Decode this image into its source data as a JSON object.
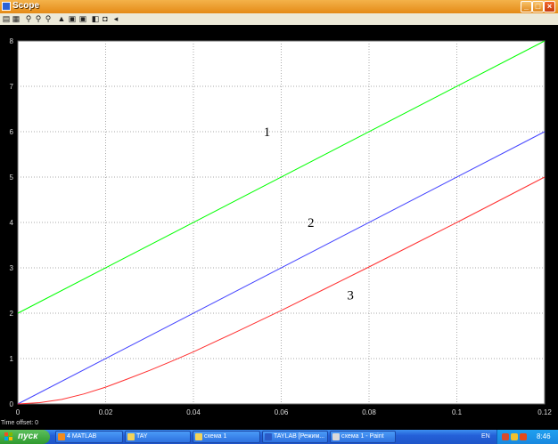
{
  "window": {
    "title": "Scope"
  },
  "toolbar": {
    "icons": [
      "print-icon",
      "parameters-icon",
      "zoom-icon",
      "zoom-x-icon",
      "zoom-y-icon",
      "autoscale-icon",
      "save-axes-icon",
      "restore-axes-icon",
      "floating-scope-icon",
      "lock-icon",
      "signal-selection-icon"
    ]
  },
  "plot": {
    "x_ticks": [
      "0",
      "0.02",
      "0.04",
      "0.06",
      "0.08",
      "0.1",
      "0.12"
    ],
    "y_ticks": [
      "0",
      "1",
      "2",
      "3",
      "4",
      "5",
      "6",
      "7",
      "8"
    ],
    "time_offset": "Time offset:  0"
  },
  "chart_data": {
    "type": "line",
    "xlim": [
      0,
      0.12
    ],
    "ylim": [
      0,
      8
    ],
    "grid": true,
    "background": "#000000",
    "annotations": [
      {
        "text": "1",
        "x": 0.056,
        "y": 5.9
      },
      {
        "text": "2",
        "x": 0.066,
        "y": 3.9
      },
      {
        "text": "3",
        "x": 0.075,
        "y": 2.3
      }
    ],
    "series": [
      {
        "color": "#00ff00",
        "x": [
          0,
          0.12
        ],
        "y": [
          2,
          8
        ]
      },
      {
        "color": "#4444ff",
        "x": [
          0,
          0.12
        ],
        "y": [
          0,
          6
        ]
      },
      {
        "color": "#ff3030",
        "x": [
          0,
          0.005,
          0.01,
          0.015,
          0.02,
          0.025,
          0.03,
          0.035,
          0.04,
          0.05,
          0.06,
          0.07,
          0.08,
          0.09,
          0.1,
          0.11,
          0.12
        ],
        "y": [
          0,
          0.03,
          0.1,
          0.22,
          0.37,
          0.55,
          0.74,
          0.94,
          1.15,
          1.6,
          2.06,
          2.54,
          3.02,
          3.51,
          4.0,
          4.5,
          5.0
        ]
      }
    ]
  },
  "taskbar": {
    "start_label": "пуск",
    "tasks": [
      {
        "label": "4 MATLAB",
        "icon_color": "#f28b1d"
      },
      {
        "label": "TAY",
        "icon_color": "#f2d35b"
      },
      {
        "label": "схема 1",
        "icon_color": "#f2d35b"
      },
      {
        "label": "TAYLAB [Режим...",
        "icon_color": "#2b5bc8"
      },
      {
        "label": "схема 1 - Paint",
        "icon_color": "#d9d9d9"
      }
    ],
    "language": "EN",
    "clock": "8:46"
  }
}
